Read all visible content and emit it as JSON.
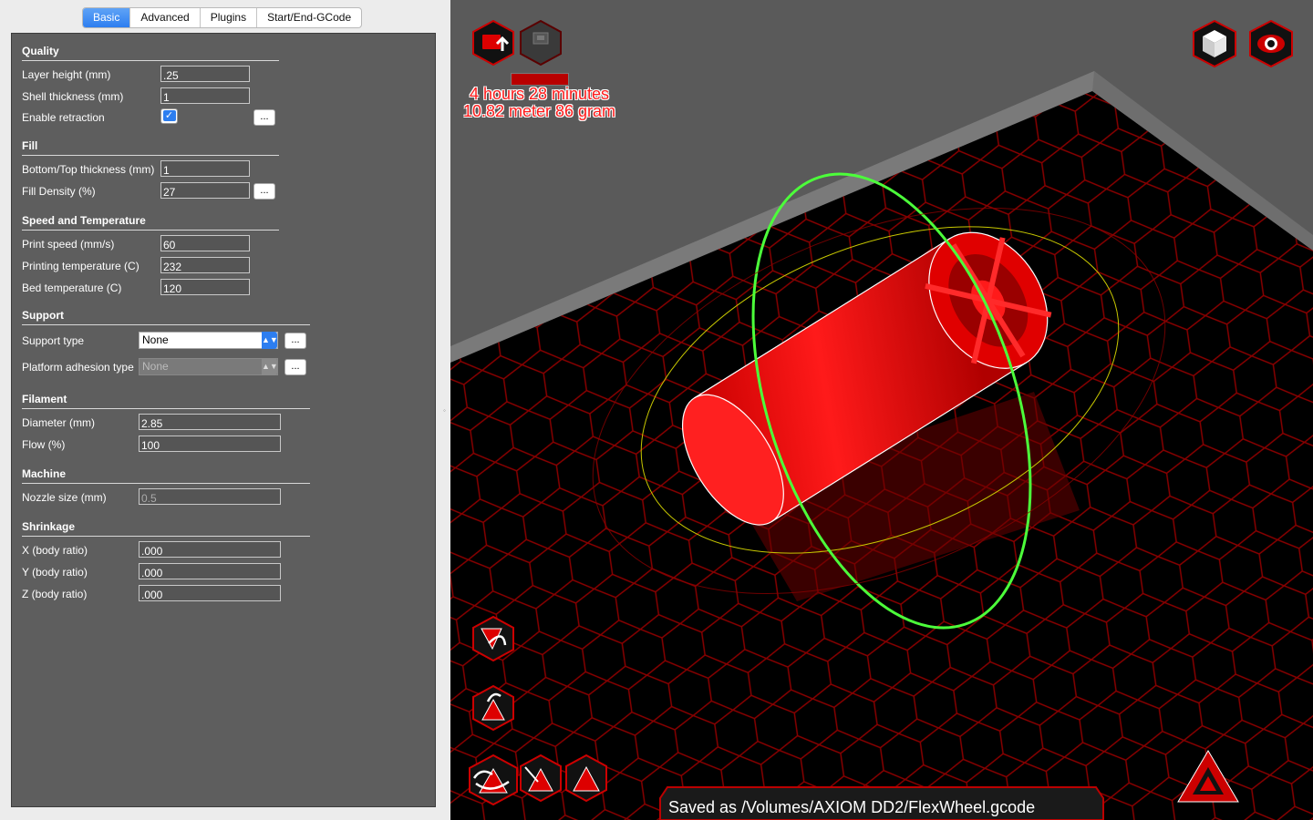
{
  "tabs": [
    {
      "label": "Basic",
      "active": true
    },
    {
      "label": "Advanced",
      "active": false
    },
    {
      "label": "Plugins",
      "active": false
    },
    {
      "label": "Start/End-GCode",
      "active": false
    }
  ],
  "settings": {
    "quality": {
      "title": "Quality",
      "layer_height": {
        "label": "Layer height (mm)",
        "value": ".25"
      },
      "shell_thickness": {
        "label": "Shell thickness (mm)",
        "value": "1"
      },
      "enable_retraction": {
        "label": "Enable retraction",
        "checked": true,
        "more": "..."
      }
    },
    "fill": {
      "title": "Fill",
      "bottom_top": {
        "label": "Bottom/Top thickness (mm)",
        "value": "1"
      },
      "density": {
        "label": "Fill Density (%)",
        "value": "27",
        "more": "..."
      }
    },
    "speed": {
      "title": "Speed and Temperature",
      "print_speed": {
        "label": "Print speed (mm/s)",
        "value": "60"
      },
      "print_temp": {
        "label": "Printing temperature (C)",
        "value": "232"
      },
      "bed_temp": {
        "label": "Bed temperature (C)",
        "value": "120"
      }
    },
    "support": {
      "title": "Support",
      "support_type": {
        "label": "Support type",
        "value": "None",
        "more": "..."
      },
      "adhesion_type": {
        "label": "Platform adhesion type",
        "value": "None",
        "more": "..."
      }
    },
    "filament": {
      "title": "Filament",
      "diameter": {
        "label": "Diameter (mm)",
        "value": "2.85"
      },
      "flow": {
        "label": "Flow (%)",
        "value": "100"
      }
    },
    "machine": {
      "title": "Machine",
      "nozzle": {
        "label": "Nozzle size (mm)",
        "value": "0.5"
      }
    },
    "shrinkage": {
      "title": "Shrinkage",
      "x": {
        "label": "X (body ratio)",
        "value": ".000"
      },
      "y": {
        "label": "Y (body ratio)",
        "value": ".000"
      },
      "z": {
        "label": "Z (body ratio)",
        "value": ".000"
      }
    }
  },
  "viewport": {
    "print_time": "4 hours 28 minutes",
    "print_material": "10.82 meter 86 gram",
    "slice_progress": 1.0,
    "status": "Saved as /Volumes/AXIOM DD2/FlexWheel.gcode",
    "colors": {
      "accent_red": "#e00000",
      "rotate_ring": "#4cff3a",
      "bed": "#000000",
      "grid": "#8a0000"
    },
    "icons": [
      "load-file-icon",
      "save-sd-icon",
      "view-cube-icon",
      "view-mode-icon",
      "rotate-tool-icon",
      "scale-tool-icon",
      "mirror-tool-icon",
      "lay-flat-icon",
      "reset-icon",
      "axiom-logo-icon"
    ]
  }
}
